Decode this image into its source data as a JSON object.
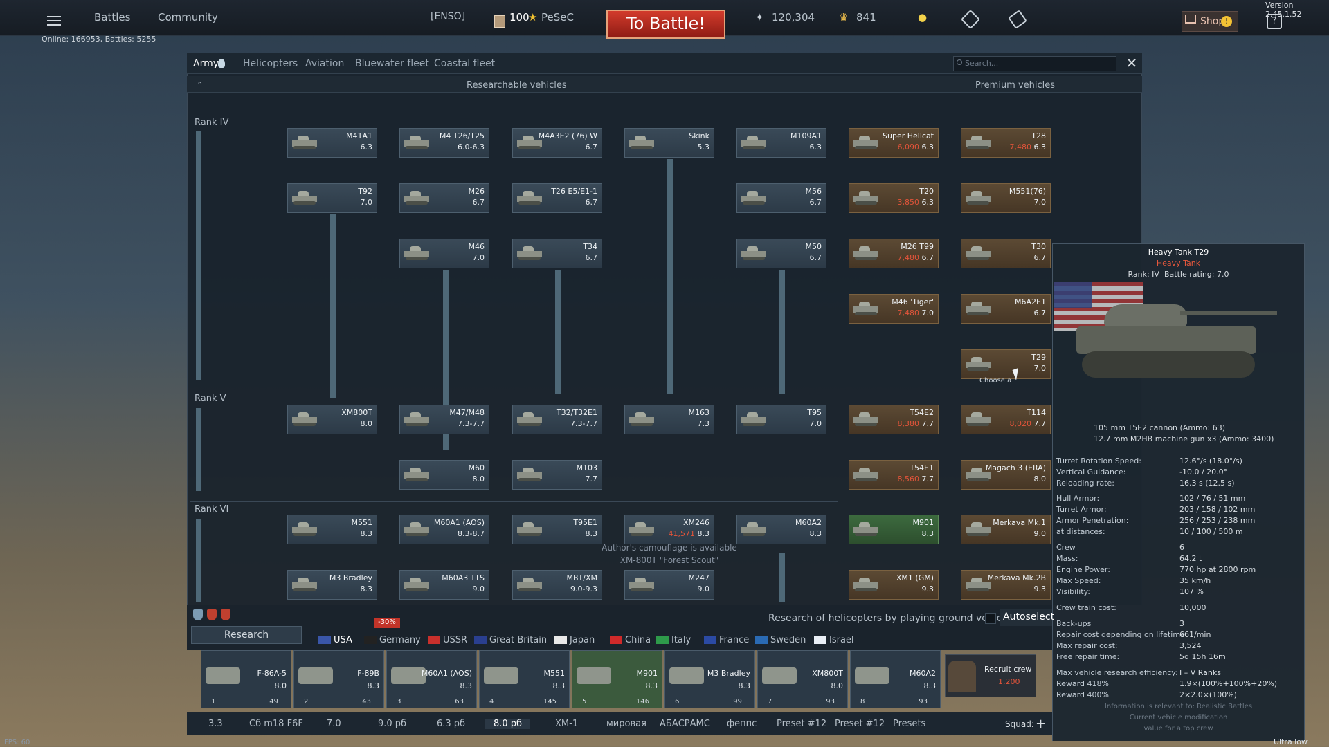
{
  "top": {
    "menu_icon": "hamburger-icon",
    "battles": "Battles",
    "community": "Community",
    "squadron_tag": "[ENSO]",
    "player_level": "100",
    "player_name": "PeSeC",
    "battle_button": "To Battle!",
    "silver_lions": "120,304",
    "golden_eagles": "841",
    "shop": "Shop",
    "version": "Version 2.45.1.52",
    "online": "Online: 166953, Battles: 5255"
  },
  "tabs": [
    {
      "label": "Army"
    },
    {
      "label": "Helicopters"
    },
    {
      "label": "Aviation"
    },
    {
      "label": "Bluewater fleet"
    },
    {
      "label": "Coastal fleet"
    }
  ],
  "search_placeholder": "Search...",
  "columns": {
    "researchable": "Researchable vehicles",
    "premium": "Premium vehicles"
  },
  "ranks": {
    "iv": "Rank IV",
    "v": "Rank V",
    "vi": "Rank VI"
  },
  "vehicles": [
    {
      "id": "m41a1",
      "name": "M41A1",
      "br": "6.3"
    },
    {
      "id": "m4t26",
      "name": "M4 T26/T25",
      "br": "6.0-6.3"
    },
    {
      "id": "m4a3e2",
      "name": "M4A3E2 (76) W",
      "br": "6.7"
    },
    {
      "id": "skink",
      "name": "Skink",
      "br": "5.3"
    },
    {
      "id": "m109a1",
      "name": "M109A1",
      "br": "6.3"
    },
    {
      "id": "superhellcat",
      "name": "Super Hellcat",
      "cost": "6,090",
      "br": "6.3"
    },
    {
      "id": "t28",
      "name": "T28",
      "cost": "7,480",
      "br": "6.3"
    },
    {
      "id": "t92",
      "name": "T92",
      "br": "7.0"
    },
    {
      "id": "m26",
      "name": "M26",
      "br": "6.7"
    },
    {
      "id": "t26e5",
      "name": "T26 E5/E1-1",
      "br": "6.7"
    },
    {
      "id": "m56",
      "name": "M56",
      "br": "6.7"
    },
    {
      "id": "t20",
      "name": "T20",
      "cost": "3,850",
      "br": "6.3"
    },
    {
      "id": "m551_76",
      "name": "M551(76)",
      "br": "7.0"
    },
    {
      "id": "m46",
      "name": "M46",
      "br": "7.0"
    },
    {
      "id": "t34",
      "name": "T34",
      "br": "6.7"
    },
    {
      "id": "m50",
      "name": "M50",
      "br": "6.7"
    },
    {
      "id": "m26t99",
      "name": "M26 T99",
      "cost": "7,480",
      "br": "6.7"
    },
    {
      "id": "t30",
      "name": "T30",
      "br": "6.7"
    },
    {
      "id": "m46tiger",
      "name": "M46 'Tiger'",
      "cost": "7,480",
      "br": "7.0"
    },
    {
      "id": "m6a2e1",
      "name": "M6A2E1",
      "br": "6.7"
    },
    {
      "id": "t29",
      "name": "T29",
      "br": "7.0"
    },
    {
      "id": "xm800t",
      "name": "XM800T",
      "br": "8.0"
    },
    {
      "id": "m47m48",
      "name": "M47/M48",
      "br": "7.3-7.7"
    },
    {
      "id": "t32",
      "name": "T32/T32E1",
      "br": "7.3-7.7"
    },
    {
      "id": "m163",
      "name": "M163",
      "br": "7.3"
    },
    {
      "id": "t95",
      "name": "T95",
      "br": "7.0"
    },
    {
      "id": "t54e2",
      "name": "T54E2",
      "cost": "8,380",
      "br": "7.7"
    },
    {
      "id": "t114",
      "name": "T114",
      "cost": "8,020",
      "br": "7.7"
    },
    {
      "id": "m60",
      "name": "M60",
      "br": "8.0"
    },
    {
      "id": "m103",
      "name": "M103",
      "br": "7.7"
    },
    {
      "id": "t54e1",
      "name": "T54E1",
      "cost": "8,560",
      "br": "7.7"
    },
    {
      "id": "magach3",
      "name": "Magach 3 (ERA)",
      "br": "8.0"
    },
    {
      "id": "m551",
      "name": "M551",
      "br": "8.3"
    },
    {
      "id": "m60a1",
      "name": "M60A1 (AOS)",
      "br": "8.3-8.7"
    },
    {
      "id": "t95e1",
      "name": "T95E1",
      "br": "8.3"
    },
    {
      "id": "xm246",
      "name": "XM246",
      "cost": "41,571",
      "br": "8.3"
    },
    {
      "id": "m60a2",
      "name": "M60A2",
      "br": "8.3"
    },
    {
      "id": "m901",
      "name": "M901",
      "br": "8.3"
    },
    {
      "id": "merkava1",
      "name": "Merkava Mk.1",
      "br": "9.0"
    },
    {
      "id": "m3bradley",
      "name": "M3 Bradley",
      "br": "8.3"
    },
    {
      "id": "m60a3",
      "name": "M60A3 TTS",
      "br": "9.0"
    },
    {
      "id": "mbtxm",
      "name": "MBT/XM",
      "br": "9.0-9.3"
    },
    {
      "id": "m247",
      "name": "M247",
      "br": "9.0"
    },
    {
      "id": "xm1gm",
      "name": "XM1 (GM)",
      "br": "9.3"
    },
    {
      "id": "merkava2b",
      "name": "Merkava Mk.2B",
      "br": "9.3"
    }
  ],
  "camo_note": [
    "Author's camouflage is available",
    "XM-800T \"Forest Scout\""
  ],
  "choose_label": "Choose a",
  "tooltip": {
    "title": "Heavy Tank T29",
    "class": "Heavy Tank",
    "rank": "Rank: IV",
    "battle_rating": "Battle rating: 7.0",
    "weapons": [
      "105 mm T5E2 cannon (Ammo: 63)",
      "12.7 mm M2HB machine gun x3 (Ammo: 3400)"
    ],
    "stats": [
      [
        "Turret Rotation Speed:",
        "12.6°/s (18.0°/s)"
      ],
      [
        "Vertical Guidance:",
        "-10.0 / 20.0°"
      ],
      [
        "Reloading rate:",
        "16.3 s (12.5 s)"
      ],
      [
        "Hull Armor:",
        "102 / 76 / 51 mm"
      ],
      [
        "Turret Armor:",
        "203 / 158 / 102 mm"
      ],
      [
        "Armor Penetration:",
        "256 / 253 / 238 mm"
      ],
      [
        "at distances:",
        "10 / 100 / 500 m"
      ],
      [
        "Crew",
        "6"
      ],
      [
        "Mass:",
        "64.2 t"
      ],
      [
        "Engine Power:",
        "770 hp at 2800 rpm"
      ],
      [
        "Max Speed:",
        "35 km/h"
      ],
      [
        "Visibility:",
        "107 %"
      ],
      [
        "Crew train cost:",
        "10,000"
      ],
      [
        "Back-ups",
        "3"
      ],
      [
        "Repair cost depending on lifetime:",
        "661/min"
      ],
      [
        "Max repair cost:",
        "3,524"
      ],
      [
        "Free repair time:",
        "5d 15h 16m"
      ],
      [
        "Max vehicle research efficiency:",
        "I – V Ranks"
      ],
      [
        "Reward 418%",
        "1.9×(100%+100%+20%)"
      ],
      [
        "Reward 400%",
        "2×2.0×(100%)"
      ]
    ],
    "footer": [
      "Information is relevant to: Realistic Battles",
      "Current vehicle modification",
      "value for a top crew"
    ]
  },
  "research_label": "Research",
  "heli_research": "Research of helicopters by playing ground vehicles",
  "autoselect": "Autoselect",
  "discount": "-30%",
  "nations": [
    "USA",
    "Germany",
    "USSR",
    "Great Britain",
    "Japan",
    "China",
    "Italy",
    "France",
    "Sweden",
    "Israel"
  ],
  "crew_slots": [
    {
      "name": "F-86A-5",
      "br": "8.0",
      "num": "1",
      "rp": "49"
    },
    {
      "name": "F-89B",
      "br": "8.3",
      "num": "2",
      "rp": "43"
    },
    {
      "name": "M60A1 (AOS)",
      "br": "8.3",
      "num": "3",
      "rp": "63"
    },
    {
      "name": "M551",
      "br": "8.3",
      "num": "4",
      "rp": "145"
    },
    {
      "name": "M901",
      "br": "8.3",
      "num": "5",
      "rp": "146"
    },
    {
      "name": "M3 Bradley",
      "br": "8.3",
      "num": "6",
      "rp": "99"
    },
    {
      "name": "XM800T",
      "br": "8.0",
      "num": "7",
      "rp": "93"
    },
    {
      "name": "M60A2",
      "br": "8.3",
      "num": "8",
      "rp": "93"
    }
  ],
  "recruit": {
    "label": "Recruit crew",
    "cost": "1,200"
  },
  "presets": [
    "3.3",
    "Сб m18 F6F",
    "7.0",
    "9.0 рб",
    "6.3 рб",
    "8.0 рб",
    "ХМ-1",
    "мировая",
    "АБАСРАМС",
    "феппс",
    "Preset #12",
    "Preset #12",
    "Presets"
  ],
  "squad": "Squad:",
  "fps": "FPS: 60",
  "quality": "Ultra low quality"
}
